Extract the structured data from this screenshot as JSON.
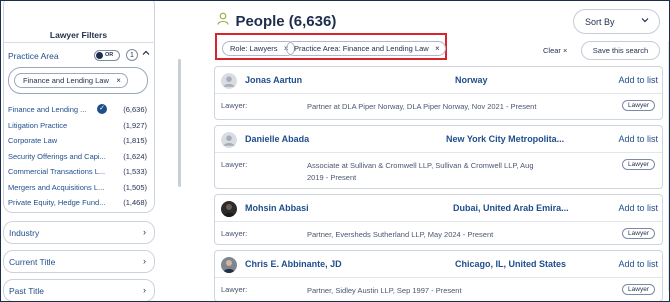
{
  "sidebar": {
    "title": "Lawyer Filters",
    "practice_area": {
      "label": "Practice Area",
      "toggle_text": "OR",
      "selected_count": "1",
      "chip": "Finance and Lending Law",
      "facets": [
        {
          "label": "Finance and Lending ...",
          "count": "(6,636)",
          "checked": true
        },
        {
          "label": "Litigation Practice",
          "count": "(1,927)"
        },
        {
          "label": "Corporate Law",
          "count": "(1,815)"
        },
        {
          "label": "Security Offerings and Capi...",
          "count": "(1,624)"
        },
        {
          "label": "Commercial Transactions L...",
          "count": "(1,533)"
        },
        {
          "label": "Mergers and Acquisitions L...",
          "count": "(1,505)"
        },
        {
          "label": "Private Equity, Hedge Fund...",
          "count": "(1,468)"
        }
      ]
    },
    "sections": [
      {
        "label": "Industry"
      },
      {
        "label": "Current Title"
      },
      {
        "label": "Past Title"
      }
    ]
  },
  "header": {
    "title": "People (6,636)",
    "sort_label": "Sort By"
  },
  "active_filters": {
    "chips": [
      "Role: Lawyers",
      "Practice Area: Finance and Lending Law"
    ],
    "clear_label": "Clear",
    "save_label": "Save this search"
  },
  "results": [
    {
      "name": "Jonas Aartun",
      "location": "Norway",
      "role_label": "Lawyer:",
      "description": "Partner at DLA Piper Norway, DLA Piper Norway, Nov 2021 - Present",
      "badge": "Lawyer",
      "add_label": "Add to list"
    },
    {
      "name": "Danielle Abada",
      "location": "New York City Metropolita...",
      "role_label": "Lawyer:",
      "description": "Associate at Sullivan & Cromwell LLP, Sullivan & Cromwell LLP, Aug 2019 - Present",
      "badge": "Lawyer",
      "add_label": "Add to list"
    },
    {
      "name": "Mohsin Abbasi",
      "location": "Dubai, United Arab Emira...",
      "role_label": "Lawyer:",
      "description": "Partner, Eversheds Sutherland LLP, May 2024 - Present",
      "badge": "Lawyer",
      "add_label": "Add to list"
    },
    {
      "name": "Chris E. Abbinante, JD",
      "location": "Chicago, IL, United States",
      "role_label": "Lawyer:",
      "description": "Partner, Sidley Austin LLP, Sep 1997 - Present",
      "badge": "Lawyer",
      "add_label": "Add to list"
    }
  ],
  "icons": {
    "close": "×",
    "chevron_down": "⌄",
    "chevron_right": "›",
    "check": "✓"
  },
  "colors": {
    "navy": "#1f2d4d",
    "link_blue": "#1f4e8c",
    "highlight_red": "#d9232e",
    "person_icon_green": "#8fae3a"
  }
}
